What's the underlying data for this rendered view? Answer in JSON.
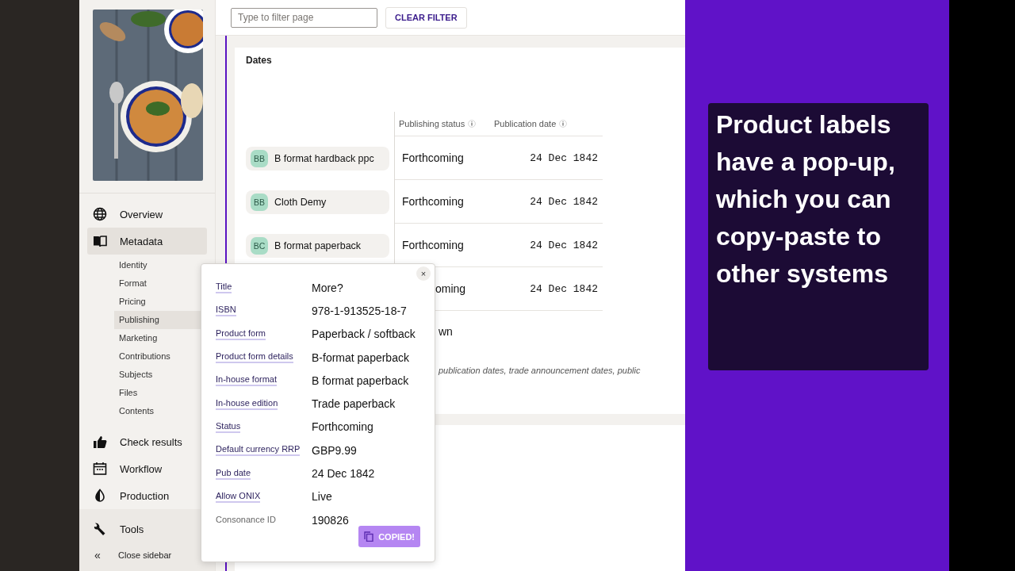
{
  "sidebar": {
    "nav": [
      {
        "label": "Overview",
        "selected": false
      },
      {
        "label": "Metadata",
        "selected": true,
        "children": [
          {
            "label": "Identity",
            "selected": false
          },
          {
            "label": "Format",
            "selected": false
          },
          {
            "label": "Pricing",
            "selected": false
          },
          {
            "label": "Publishing",
            "selected": true
          },
          {
            "label": "Marketing",
            "selected": false
          },
          {
            "label": "Contributions",
            "selected": false
          },
          {
            "label": "Subjects",
            "selected": false
          },
          {
            "label": "Files",
            "selected": false
          },
          {
            "label": "Contents",
            "selected": false
          }
        ]
      },
      {
        "label": "Check results",
        "selected": false
      },
      {
        "label": "Workflow",
        "selected": false
      },
      {
        "label": "Production",
        "selected": false
      }
    ],
    "footer": [
      {
        "label": "Tools"
      }
    ],
    "close": {
      "glyph": "«",
      "label": "Close sidebar"
    }
  },
  "filter": {
    "placeholder": "Type to filter page",
    "button": "CLEAR FILTER"
  },
  "dates": {
    "title": "Dates",
    "columns": [
      "Publishing status",
      "Publication date"
    ],
    "rows": [
      {
        "badge": "BB",
        "product": "B format hardback ppc",
        "status": "Forthcoming",
        "date": "24 Dec 1842"
      },
      {
        "badge": "BB",
        "product": "Cloth Demy",
        "status": "Forthcoming",
        "date": "24 Dec 1842"
      },
      {
        "badge": "BC",
        "product": "B format paperback",
        "status": "Forthcoming",
        "date": "24 Dec 1842"
      },
      {
        "status": "oming",
        "date": "24 Dec 1842"
      }
    ],
    "note": "wn",
    "description": "publication dates, trade announcement dates, public"
  },
  "popup": {
    "fields": [
      {
        "label": "Title",
        "value": "More?",
        "kind": "link"
      },
      {
        "label": "ISBN",
        "value": "978-1-913525-18-7",
        "kind": "link"
      },
      {
        "label": "Product form",
        "value": "Paperback / softback",
        "kind": "link"
      },
      {
        "label": "Product form details",
        "value": "B-format paperback",
        "kind": "link"
      },
      {
        "label": "In-house format",
        "value": "B format paperback",
        "kind": "link"
      },
      {
        "label": "In-house edition",
        "value": "Trade paperback",
        "kind": "link"
      },
      {
        "label": "Status",
        "value": "Forthcoming",
        "kind": "link"
      },
      {
        "label": "Default currency RRP",
        "value": "GBP9.99",
        "kind": "link"
      },
      {
        "label": "Pub date",
        "value": "24 Dec 1842",
        "kind": "link"
      },
      {
        "label": "Allow ONIX",
        "value": "Live",
        "kind": "link"
      },
      {
        "label": "Consonance ID",
        "value": "190826",
        "kind": "plain"
      }
    ],
    "close": "×",
    "copy_button": "COPIED!"
  },
  "caption": "Product labels have a pop-up, which you can copy-paste to other systems"
}
